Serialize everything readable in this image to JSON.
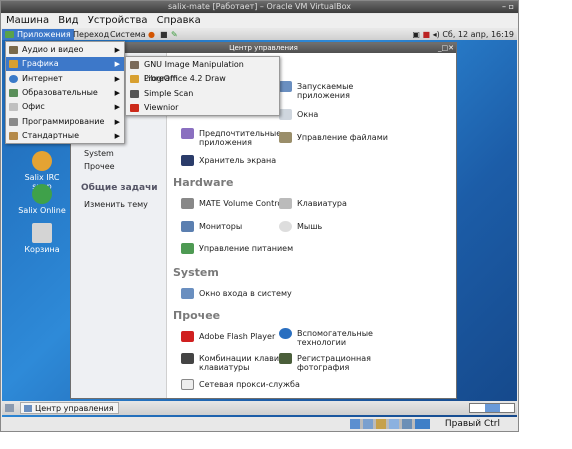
{
  "host_window": {
    "title": "salix-mate [Работает] – Oracle VM VirtualBox",
    "menu": [
      "Машина",
      "Вид",
      "Устройства",
      "Справка"
    ],
    "host_key": "Правый Ctrl"
  },
  "panel": {
    "applications": "Приложения",
    "places": "Переход",
    "system": "Система",
    "clock": "Сб, 12 апр, 16:19"
  },
  "desktop_icons": [
    "Salix IRC supp",
    "Salix Online",
    "Корзина"
  ],
  "app_menu": {
    "items": [
      "Аудио и видео",
      "Графика",
      "Интернет",
      "Образовательные",
      "Офис",
      "Программирование",
      "Стандартные"
    ],
    "selected": "Графика"
  },
  "graphics_submenu": [
    "GNU Image Manipulation Program",
    "LibreOffice 4.2 Draw",
    "Simple Scan",
    "Viewnior"
  ],
  "control_center": {
    "title": "Центр управления",
    "sidebar": {
      "groups_partial": [
        "System",
        "Прочее"
      ],
      "tasks_header": "Общие задачи",
      "change_theme": "Изменить тему"
    },
    "personal_items": [
      "Запускаемые приложения",
      "Окна",
      "Предпочтительные приложения",
      "Управление файлами",
      "Хранитель экрана"
    ],
    "sections": {
      "hardware": {
        "title": "Hardware",
        "items": [
          "MATE Volume Control",
          "Клавиатура",
          "Мониторы",
          "Мышь",
          "Управление питанием"
        ]
      },
      "system": {
        "title": "System",
        "items": [
          "Окно входа в систему"
        ]
      },
      "other": {
        "title": "Прочее",
        "items": [
          "Adobe Flash Player",
          "Вспомогательные технологии",
          "Комбинации клавиш клавиатуры",
          "Регистрационная фотография",
          "Сетевая прокси-служба"
        ]
      }
    }
  },
  "taskbar": {
    "window_button": "Центр управления"
  }
}
